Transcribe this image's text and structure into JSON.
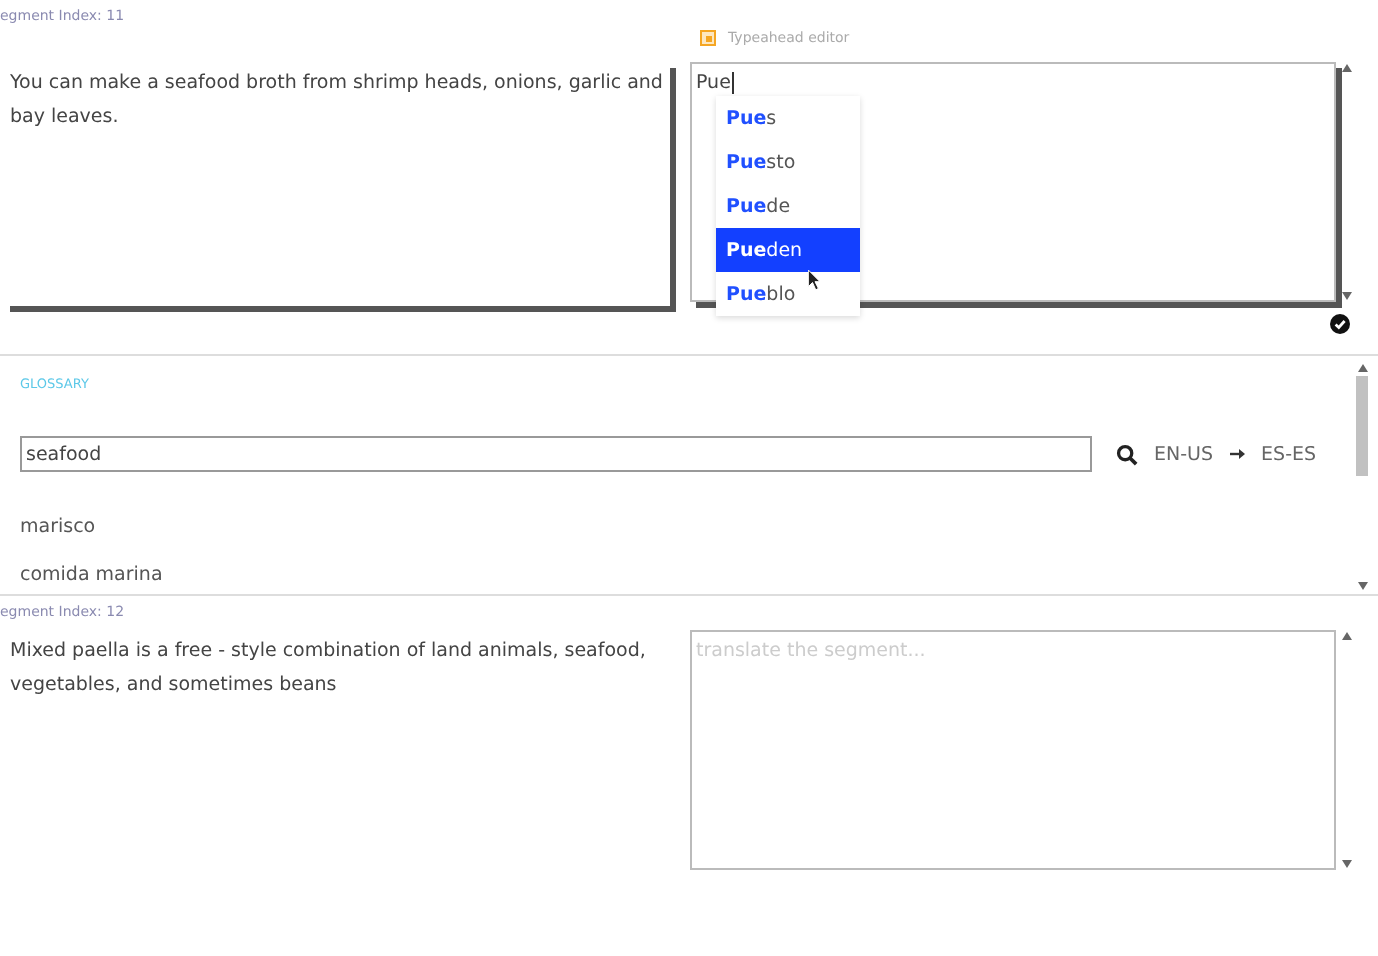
{
  "segments": [
    {
      "index_label": "egment Index: 11",
      "source": "You can make a seafood broth from shrimp heads, onions, garlic and bay leaves.",
      "editor_label": "Typeahead editor",
      "target_value": "Pue",
      "focused": true,
      "suggestions": [
        {
          "match": "Pue",
          "rest": "s",
          "selected": false
        },
        {
          "match": "Pue",
          "rest": "sto",
          "selected": false
        },
        {
          "match": "Pue",
          "rest": "de",
          "selected": false
        },
        {
          "match": "Pue",
          "rest": "den",
          "selected": true
        },
        {
          "match": "Pue",
          "rest": "blo",
          "selected": false
        }
      ]
    },
    {
      "index_label": "egment Index: 12",
      "source": "Mixed paella is a free - style combination of land animals, seafood, vegetables, and sometimes beans",
      "target_placeholder": "translate the segment...",
      "focused": false
    }
  ],
  "glossary": {
    "title": "GLOSSARY",
    "search_value": "seafood",
    "source_lang": "EN-US",
    "target_lang": "ES-ES",
    "terms": [
      "marisco",
      "comida marina"
    ]
  }
}
